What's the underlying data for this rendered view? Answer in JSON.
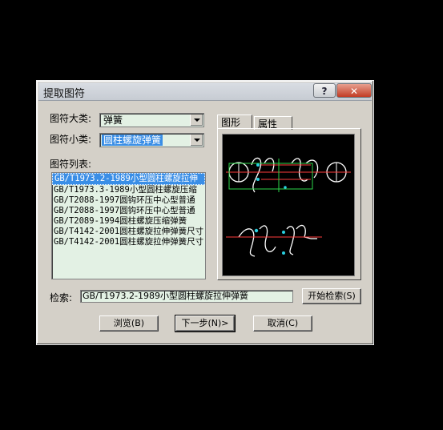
{
  "dialog": {
    "title": "提取图符",
    "help_label": "?",
    "close_label": "✕"
  },
  "category": {
    "label": "图符大类:",
    "value": "弹簧"
  },
  "subcategory": {
    "label": "图符小类:",
    "value": "圆柱螺旋弹簧"
  },
  "list": {
    "label": "图符列表:",
    "items": [
      "GB/T1973.2-1989小型圆柱螺旋拉伸",
      "GB/T1973.3-1989小型圆柱螺旋压缩",
      "GB/T2088-1997圆钩环压中心型普通",
      "GB/T2088-1997圆钩环压中心型普通",
      "GB/T2089-1994圆柱螺旋压缩弹簧",
      "GB/T4142-2001圆柱螺旋拉伸弹簧尺寸",
      "GB/T4142-2001圆柱螺旋拉伸弹簧尺寸"
    ],
    "selected_index": 0
  },
  "tabs": [
    {
      "label": "图形"
    },
    {
      "label": "属性"
    }
  ],
  "search": {
    "label": "检索:",
    "value": "GB/T1973.2-1989小型圆柱螺旋拉伸弹簧",
    "button_label": "开始检索(S)"
  },
  "buttons": {
    "browse": "浏览(B)",
    "next": "下一步(N)>",
    "cancel": "取消(C)"
  },
  "colors": {
    "dialog_bg": "#d4d0c8",
    "field_bg": "#e3f1e4",
    "selection": "#3a8ee6",
    "preview_bg": "#000000"
  }
}
